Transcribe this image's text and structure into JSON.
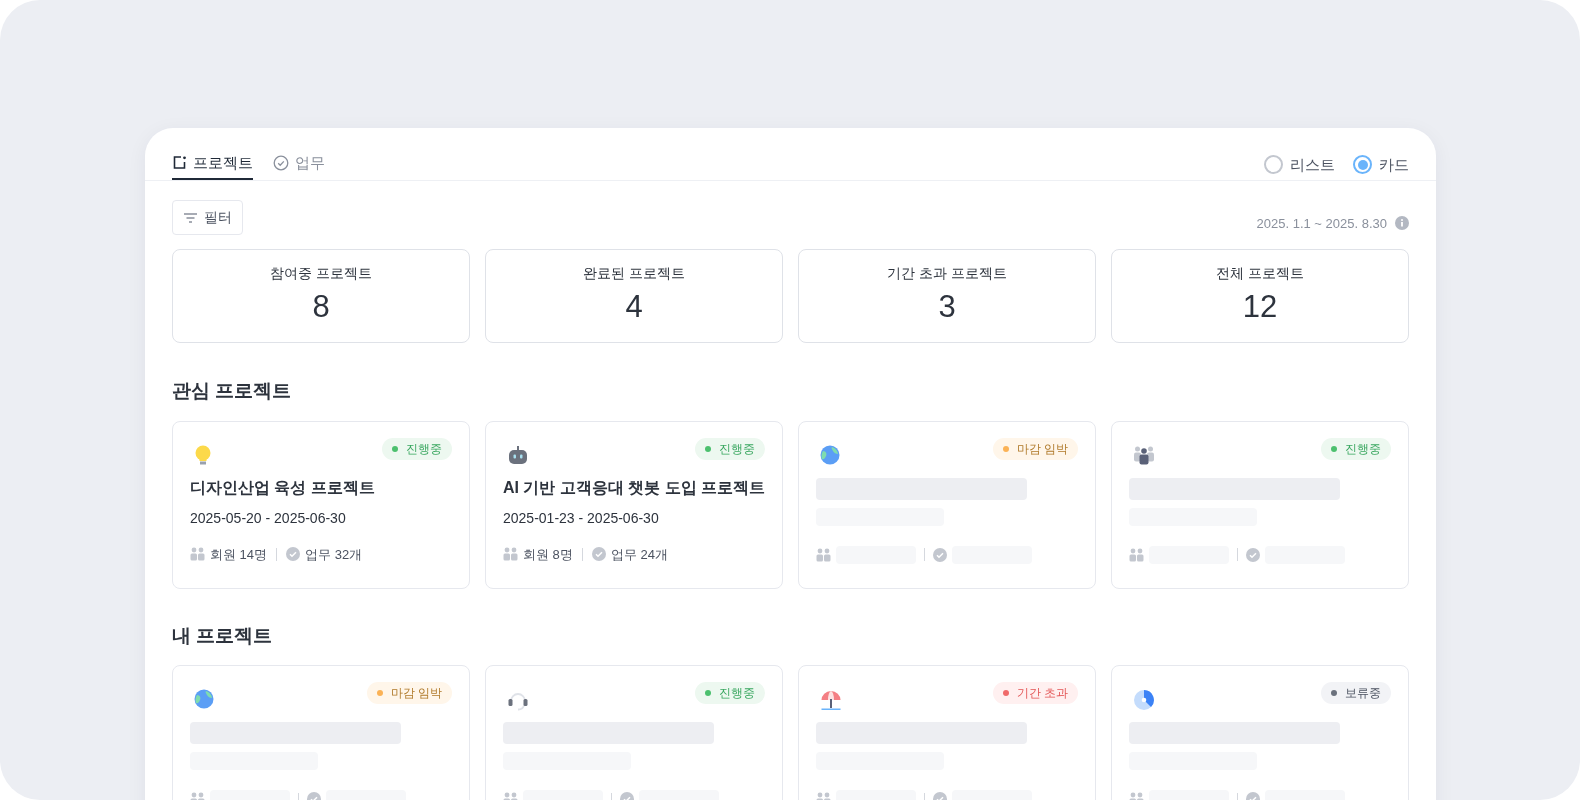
{
  "tabs": [
    {
      "label": "프로젝트",
      "selected": true
    },
    {
      "label": "업무",
      "selected": false
    }
  ],
  "view_options": [
    {
      "label": "리스트",
      "selected": false
    },
    {
      "label": "카드",
      "selected": true
    }
  ],
  "filter_button": "필터",
  "date_range": "2025. 1.1 ~ 2025. 8.30",
  "stats": [
    {
      "label": "참여중 프로젝트",
      "value": "8"
    },
    {
      "label": "완료된 프로젝트",
      "value": "4"
    },
    {
      "label": "기간 초과 프로젝트",
      "value": "3"
    },
    {
      "label": "전체 프로젝트",
      "value": "12"
    }
  ],
  "sections": [
    {
      "title": "관심 프로젝트",
      "cards": [
        {
          "kind": "detail",
          "status": {
            "kind": "in_progress",
            "label": "진행중"
          },
          "title": "디자인산업 육성 프로젝트",
          "period": "2025-05-20 - 2025-06-30",
          "members": "회원 14명",
          "tasks": "업무 32개"
        },
        {
          "kind": "detail",
          "status": {
            "kind": "in_progress",
            "label": "진행중"
          },
          "title": "AI 기반 고객응대 챗봇 도입 프로젝트",
          "period": "2025-01-23 - 2025-06-30",
          "members": "회원 8명",
          "tasks": "업무 24개"
        },
        {
          "kind": "loading",
          "status": {
            "kind": "due_soon",
            "label": "마감 임박"
          }
        },
        {
          "kind": "loading",
          "status": {
            "kind": "in_progress",
            "label": "진행중"
          }
        }
      ]
    },
    {
      "title": "내 프로젝트",
      "cards": [
        {
          "kind": "loading",
          "status": {
            "kind": "due_soon",
            "label": "마감 임박"
          }
        },
        {
          "kind": "loading",
          "status": {
            "kind": "in_progress",
            "label": "진행중"
          }
        },
        {
          "kind": "loading",
          "status": {
            "kind": "overdue",
            "label": "기간 초과"
          }
        },
        {
          "kind": "loading",
          "status": {
            "kind": "on_hold",
            "label": "보류중"
          }
        }
      ]
    }
  ]
}
